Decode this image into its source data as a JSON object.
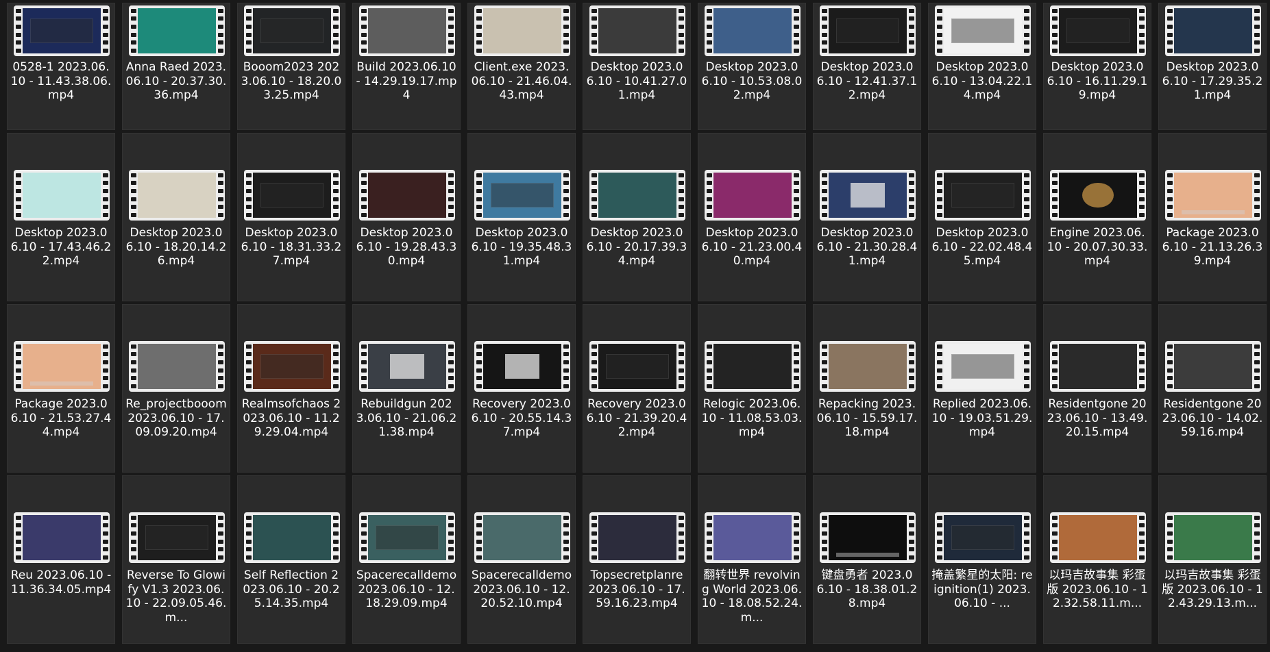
{
  "files": [
    {
      "name": "0528-1 2023.06.10 - 11.43.38.06.mp4",
      "thumb": "#1c2a5a",
      "overlay": "dialog"
    },
    {
      "name": "Anna Raed 2023.06.10 - 20.37.30.36.mp4",
      "thumb": "#1d8a7a",
      "overlay": ""
    },
    {
      "name": "Booom2023 2023.06.10 - 18.20.03.25.mp4",
      "thumb": "#222426",
      "overlay": "dialog"
    },
    {
      "name": "Build 2023.06.10 - 14.29.19.17.mp4",
      "thumb": "#5d5d5d",
      "overlay": ""
    },
    {
      "name": "Client.exe 2023.06.10 - 21.46.04.43.mp4",
      "thumb": "#c9c1b0",
      "overlay": ""
    },
    {
      "name": "Desktop 2023.06.10 - 10.41.27.01.mp4",
      "thumb": "#3b3b3b",
      "overlay": ""
    },
    {
      "name": "Desktop 2023.06.10 - 10.53.08.02.mp4",
      "thumb": "#3e5f8a",
      "overlay": ""
    },
    {
      "name": "Desktop 2023.06.10 - 12.41.37.12.mp4",
      "thumb": "#1b1b1b",
      "overlay": "dialog"
    },
    {
      "name": "Desktop 2023.06.10 - 13.04.22.14.mp4",
      "thumb": "#f2f2f2",
      "overlay": "dialog"
    },
    {
      "name": "Desktop 2023.06.10 - 16.11.29.19.mp4",
      "thumb": "#1c1c1c",
      "overlay": "dialog"
    },
    {
      "name": "Desktop 2023.06.10 - 17.29.35.21.mp4",
      "thumb": "#24364d",
      "overlay": ""
    },
    {
      "name": "Desktop 2023.06.10 - 17.43.46.22.mp4",
      "thumb": "#bde6e2",
      "overlay": ""
    },
    {
      "name": "Desktop 2023.06.10 - 18.20.14.26.mp4",
      "thumb": "#d8d2c2",
      "overlay": ""
    },
    {
      "name": "Desktop 2023.06.10 - 18.31.33.27.mp4",
      "thumb": "#1d1d1d",
      "overlay": "dialog"
    },
    {
      "name": "Desktop 2023.06.10 - 19.28.43.30.mp4",
      "thumb": "#3a2020",
      "overlay": ""
    },
    {
      "name": "Desktop 2023.06.10 - 19.35.48.31.mp4",
      "thumb": "#3f7aa0",
      "overlay": "dialog"
    },
    {
      "name": "Desktop 2023.06.10 - 20.17.39.34.mp4",
      "thumb": "#2d5a5a",
      "overlay": ""
    },
    {
      "name": "Desktop 2023.06.10 - 21.23.00.40.mp4",
      "thumb": "#8a2a6a",
      "overlay": ""
    },
    {
      "name": "Desktop 2023.06.10 - 21.30.28.41.mp4",
      "thumb": "#2c3e6a",
      "overlay": "panel"
    },
    {
      "name": "Desktop 2023.06.10 - 22.02.48.45.mp4",
      "thumb": "#202020",
      "overlay": "dialog"
    },
    {
      "name": "Engine 2023.06.10 - 20.07.30.33.mp4",
      "thumb": "#141414",
      "overlay": "logo"
    },
    {
      "name": "Package 2023.06.10 - 21.13.26.39.mp4",
      "thumb": "#e7b08c",
      "overlay": "bar"
    },
    {
      "name": "Package 2023.06.10 - 21.53.27.44.mp4",
      "thumb": "#e7b08c",
      "overlay": "bar"
    },
    {
      "name": "Re_projectbooom 2023.06.10 - 17.09.09.20.mp4",
      "thumb": "#6e6e6e",
      "overlay": ""
    },
    {
      "name": "Realmsofchaos 2023.06.10 - 11.29.29.04.mp4",
      "thumb": "#5a2a1a",
      "overlay": "dialog"
    },
    {
      "name": "Rebuildgun 2023.06.10 - 21.06.21.38.mp4",
      "thumb": "#3a3f46",
      "overlay": "panel"
    },
    {
      "name": "Recovery 2023.06.10 - 20.55.14.37.mp4",
      "thumb": "#151515",
      "overlay": "panel"
    },
    {
      "name": "Recovery 2023.06.10 - 21.39.20.42.mp4",
      "thumb": "#1a1a1a",
      "overlay": "dialog"
    },
    {
      "name": "Relogic 2023.06.10 - 11.08.53.03.mp4",
      "thumb": "#232323",
      "overlay": ""
    },
    {
      "name": "Repacking 2023.06.10 - 15.59.17.18.mp4",
      "thumb": "#8a7560",
      "overlay": ""
    },
    {
      "name": "Replied 2023.06.10 - 19.03.51.29.mp4",
      "thumb": "#f0f0f0",
      "overlay": "dialog"
    },
    {
      "name": "Residentgone 2023.06.10 - 13.49.20.15.mp4",
      "thumb": "#2a2a2a",
      "overlay": ""
    },
    {
      "name": "Residentgone 2023.06.10 - 14.02.59.16.mp4",
      "thumb": "#3c3c3c",
      "overlay": ""
    },
    {
      "name": "Reu 2023.06.10 - 11.36.34.05.mp4",
      "thumb": "#3a3a6a",
      "overlay": ""
    },
    {
      "name": "Reverse To Glowify V1.3 2023.06.10 - 22.09.05.46.m...",
      "thumb": "#1e1e1e",
      "overlay": "dialog"
    },
    {
      "name": "Self Reflection 2023.06.10 - 20.25.14.35.mp4",
      "thumb": "#2c5252",
      "overlay": ""
    },
    {
      "name": "Spacerecalldemo 2023.06.10 - 12.18.29.09.mp4",
      "thumb": "#3a6060",
      "overlay": "dialog"
    },
    {
      "name": "Spacerecalldemo 2023.06.10 - 12.20.52.10.mp4",
      "thumb": "#4a6a6a",
      "overlay": ""
    },
    {
      "name": "Topsecretplanre 2023.06.10 - 17.59.16.23.mp4",
      "thumb": "#2c2c3c",
      "overlay": ""
    },
    {
      "name": "翻转世界 revolving World 2023.06.10 - 18.08.52.24.m...",
      "thumb": "#5a5a9a",
      "overlay": ""
    },
    {
      "name": "键盘勇者 2023.06.10 - 18.38.01.28.mp4",
      "thumb": "#0e0e0e",
      "overlay": "bar"
    },
    {
      "name": "掩盖繁星的太阳: reignition(1) 2023.06.10 - ...",
      "thumb": "#1f2a3a",
      "overlay": "dialog"
    },
    {
      "name": "以玛吉故事集 彩蛋版 2023.06.10 - 12.32.58.11.m...",
      "thumb": "#b06a3a",
      "overlay": ""
    },
    {
      "name": "以玛吉故事集 彩蛋版 2023.06.10 - 12.43.29.13.m...",
      "thumb": "#3a7a4a",
      "overlay": ""
    }
  ]
}
